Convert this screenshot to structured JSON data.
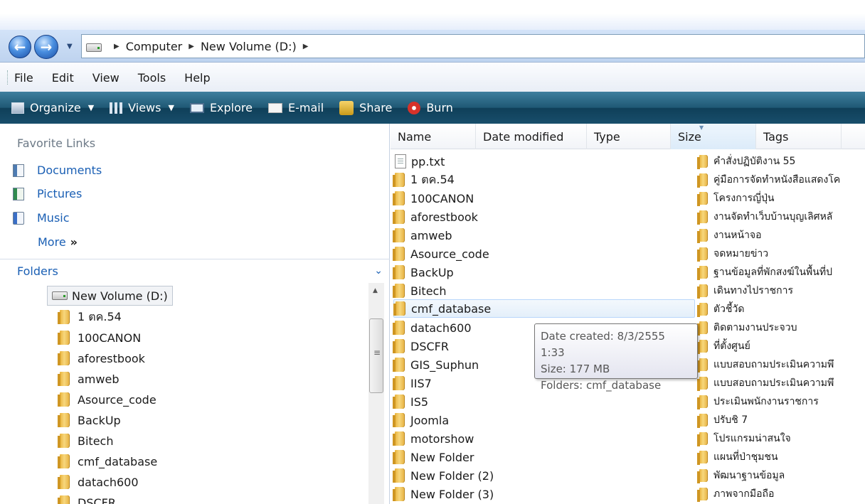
{
  "address": {
    "crumbs": [
      "Computer",
      "New Volume (D:)"
    ]
  },
  "menu": [
    "File",
    "Edit",
    "View",
    "Tools",
    "Help"
  ],
  "toolbar": {
    "organize": "Organize",
    "views": "Views",
    "explore": "Explore",
    "email": "E-mail",
    "share": "Share",
    "burn": "Burn"
  },
  "favorites": {
    "title": "Favorite Links",
    "items": [
      "Documents",
      "Pictures",
      "Music"
    ],
    "more": "More"
  },
  "folders": {
    "title": "Folders",
    "root": "New Volume (D:)",
    "items": [
      "1 ตค.54",
      "100CANON",
      "aforestbook",
      "amweb",
      "Asource_code",
      "BackUp",
      "Bitech",
      "cmf_database",
      "datach600",
      "DSCFR"
    ]
  },
  "columns": [
    "Name",
    "Date modified",
    "Type",
    "Size",
    "Tags"
  ],
  "files": {
    "col1": [
      "pp.txt",
      "1 ตค.54",
      "100CANON",
      "aforestbook",
      "amweb",
      "Asource_code",
      "BackUp",
      "Bitech",
      "cmf_database",
      "datach600",
      "DSCFR",
      "GIS_Suphun",
      "IIS7",
      "IS5",
      "Joomla",
      "motorshow",
      "New Folder",
      "New Folder (2)",
      "New Folder (3)"
    ],
    "col2": [
      "คำสั่งปฏิบัติงาน 55",
      "คู่มือการจัดทำหนังสือแสดงโค",
      "โครงการญี่ปุ่น",
      "งานจัดทำเว็บบ้านบุญเลิศหลั",
      "งานหน้าจอ",
      "จดหมายข่าว",
      "ฐานข้อมูลที่พักสงฆ์ในพื้นที่ป",
      "เดินทางไปราชการ",
      "ตัวชี้วัด",
      "ติดตามงานประจวบ",
      "ที่ตั้งศูนย์",
      "แบบสอบถามประเมินความพึ",
      "แบบสอบถามประเมินความพึ",
      "ประเมินพนักงานราชการ",
      "ปรับชิ 7",
      "โปรแกรมน่าสนใจ",
      "แผนที่ป่าชุมชน",
      "พัฒนาฐานข้อมูล",
      "ภาพจากมือถือ"
    ]
  },
  "tooltip": {
    "created": "Date created: 8/3/2555 1:33",
    "size": "Size: 177 MB",
    "folders": "Folders: cmf_database"
  }
}
